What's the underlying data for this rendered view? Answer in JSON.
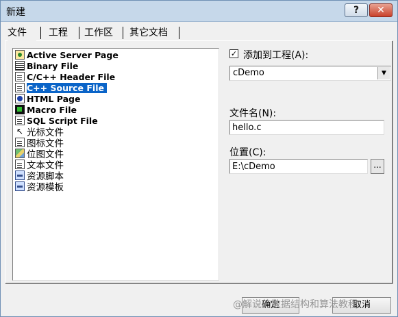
{
  "window": {
    "title": "新建",
    "help_label": "?",
    "close_label": "✕"
  },
  "tabs": [
    {
      "label": "文件"
    },
    {
      "label": "工程"
    },
    {
      "label": "工作区"
    },
    {
      "label": "其它文档"
    }
  ],
  "file_types": [
    {
      "label": "Active Server Page",
      "icon": "asp-icon"
    },
    {
      "label": "Binary File",
      "icon": "binary-file-icon"
    },
    {
      "label": "C/C++ Header File",
      "icon": "header-file-icon"
    },
    {
      "label": "C++ Source File",
      "icon": "cpp-source-icon",
      "selected": true
    },
    {
      "label": "HTML Page",
      "icon": "html-page-icon"
    },
    {
      "label": "Macro File",
      "icon": "macro-file-icon"
    },
    {
      "label": "SQL Script File",
      "icon": "sql-script-icon"
    },
    {
      "label": "光标文件",
      "icon": "cursor-file-icon"
    },
    {
      "label": "图标文件",
      "icon": "icon-file-icon"
    },
    {
      "label": "位图文件",
      "icon": "bitmap-file-icon"
    },
    {
      "label": "文本文件",
      "icon": "text-file-icon"
    },
    {
      "label": "资源脚本",
      "icon": "resource-script-icon"
    },
    {
      "label": "资源模板",
      "icon": "resource-template-icon"
    }
  ],
  "options": {
    "add_to_project_label": "添加到工程(A):",
    "add_to_project_checked": true,
    "project_value": "cDemo",
    "filename_label": "文件名(N):",
    "filename_value": "hello.c",
    "location_label": "位置(C):",
    "location_value": "E:\\cDemo",
    "browse_label": "..."
  },
  "buttons": {
    "ok": "确定",
    "cancel": "取消"
  },
  "watermark": "@解说的数据结构和算法教程",
  "colors": {
    "selection": "#0a64c8",
    "close_button": "#c9412b"
  }
}
